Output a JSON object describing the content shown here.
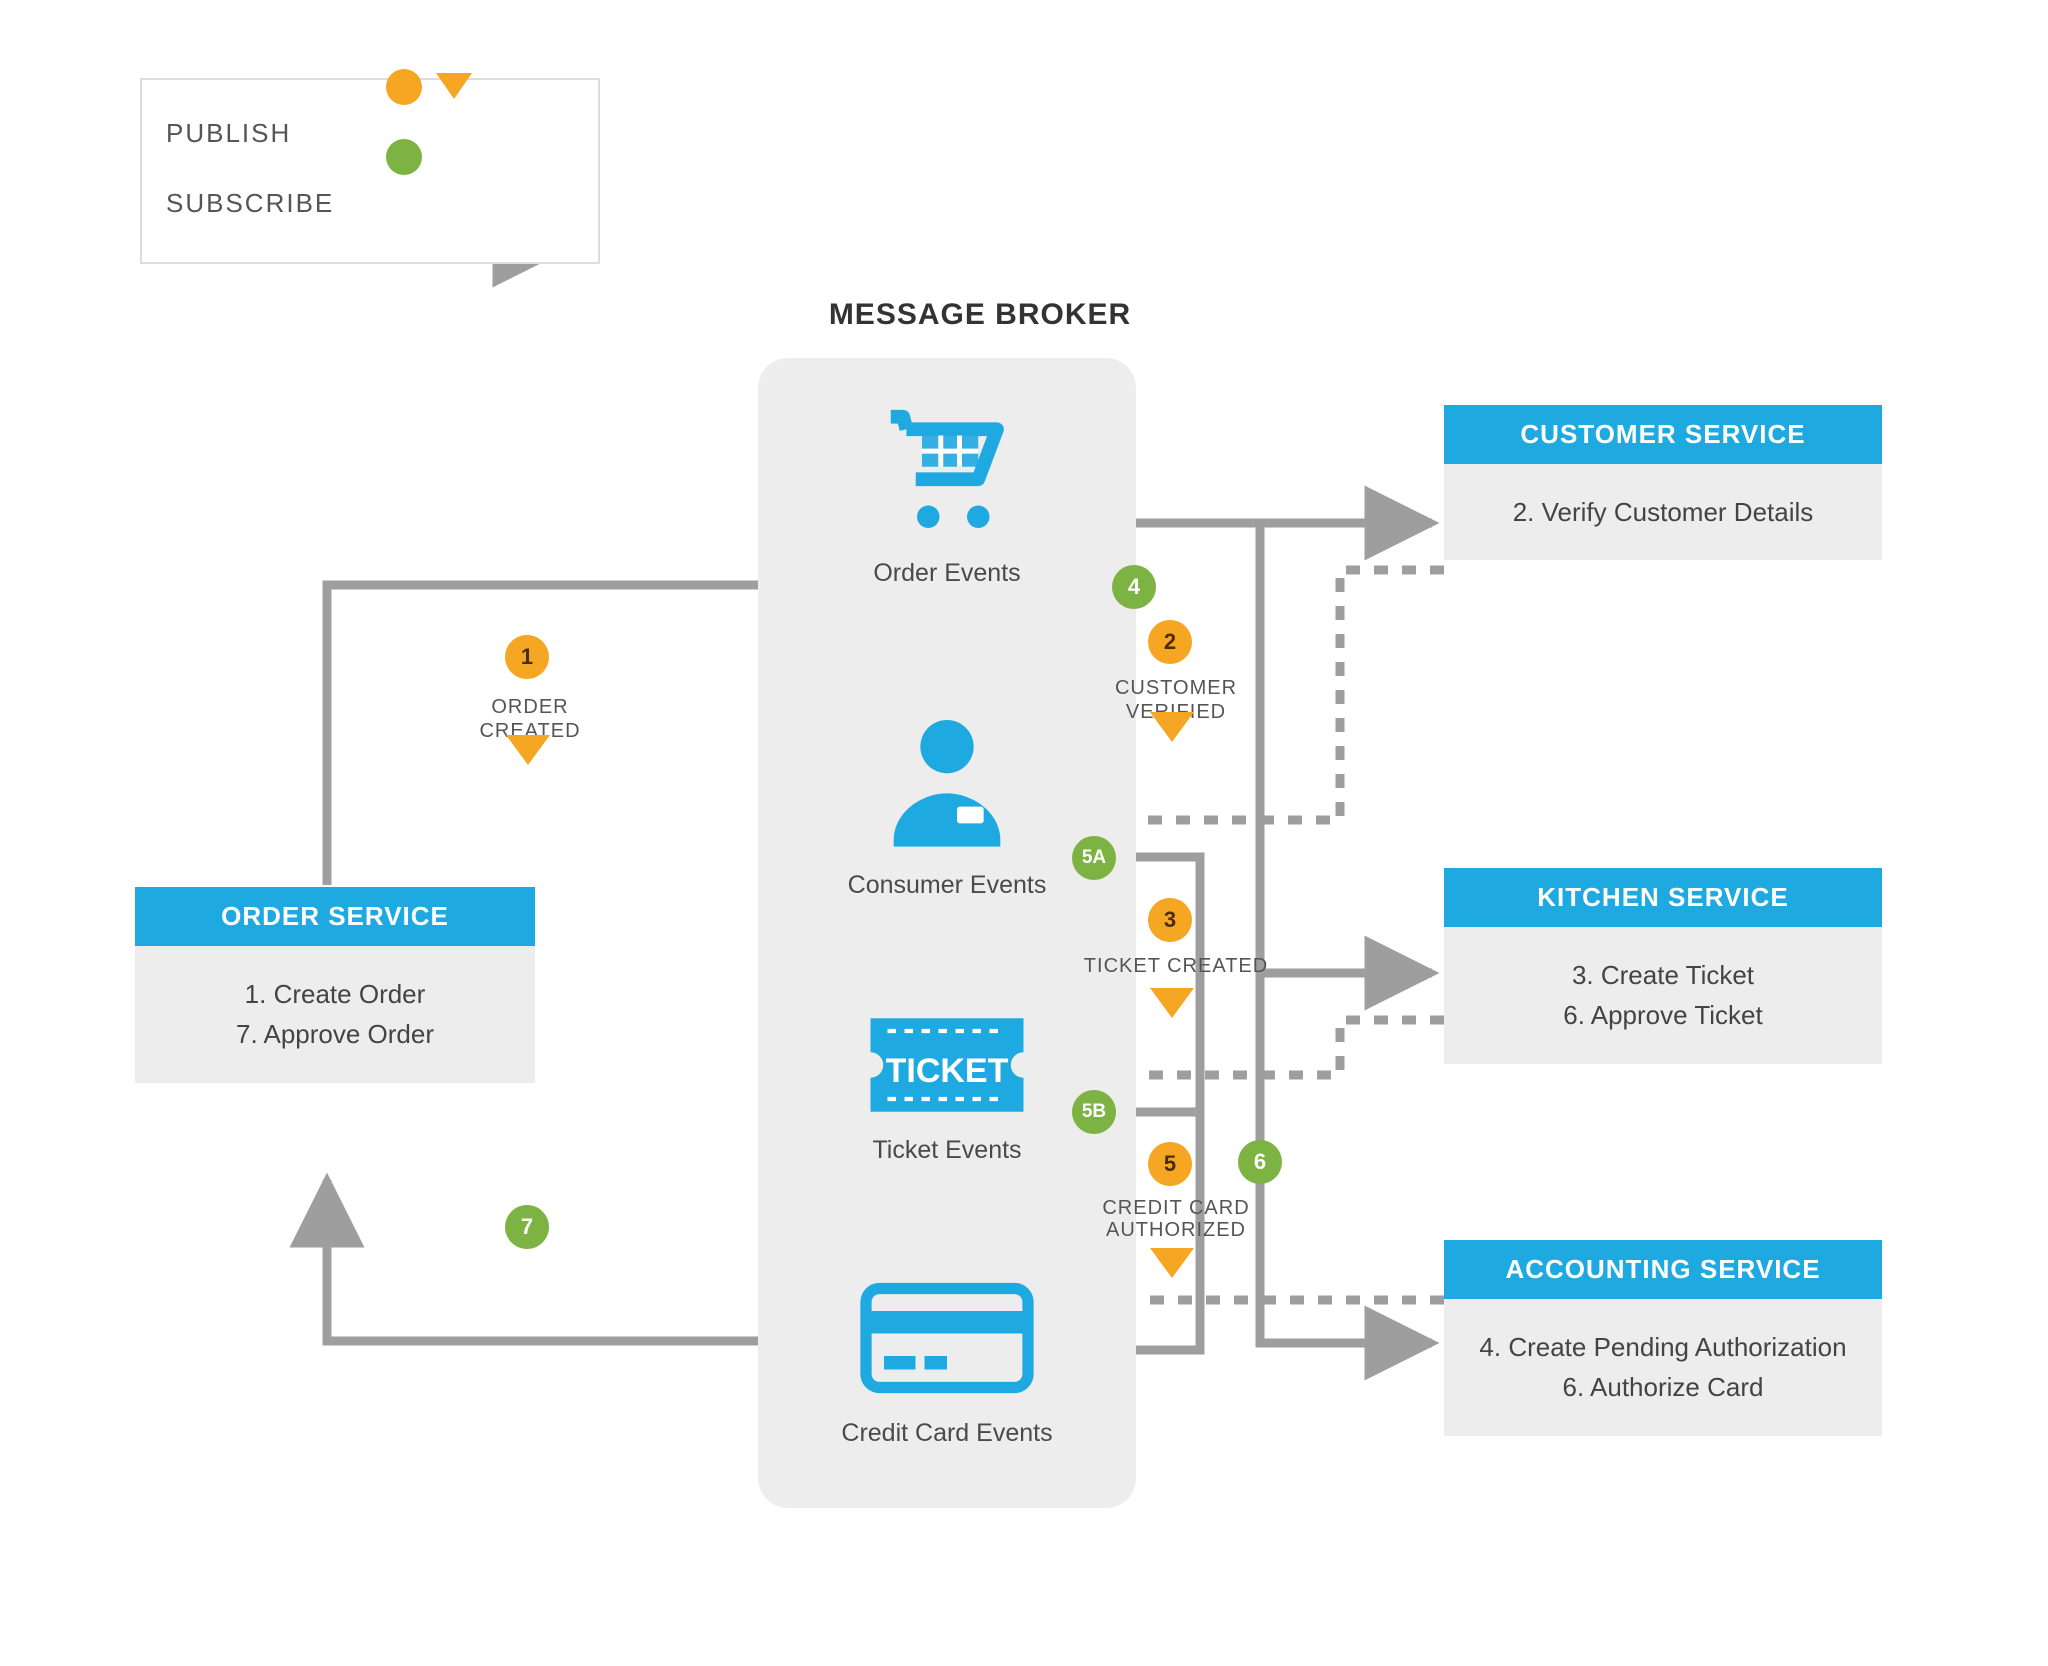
{
  "title": "MESSAGE BROKER",
  "legend": {
    "publish_label": "PUBLISH",
    "subscribe_label": "SUBSCRIBE"
  },
  "broker": {
    "order_events": "Order Events",
    "consumer_events": "Consumer Events",
    "ticket_events": "Ticket Events",
    "credit_events": "Credit Card Events"
  },
  "services": {
    "order": {
      "title": "ORDER SERVICE",
      "line1": "1. Create Order",
      "line2": "7. Approve Order"
    },
    "customer": {
      "title": "CUSTOMER SERVICE",
      "line1": "2. Verify Customer Details"
    },
    "kitchen": {
      "title": "KITCHEN SERVICE",
      "line1": "3. Create Ticket",
      "line2": "6. Approve Ticket"
    },
    "accounting": {
      "title": "ACCOUNTING SERVICE",
      "line1": "4. Create Pending Authorization",
      "line2": "6. Authorize Card"
    }
  },
  "steps": {
    "s1": "1",
    "s2": "2",
    "s3": "3",
    "s4": "4",
    "s5": "5",
    "s5a": "5A",
    "s5b": "5B",
    "s6": "6",
    "s7": "7",
    "order_created": "ORDER CREATED",
    "customer_verified": "CUSTOMER VERIFIED",
    "ticket_created": "TICKET CREATED",
    "credit_authorized_l1": "CREDIT CARD",
    "credit_authorized_l2": "AUTHORIZED"
  },
  "colors": {
    "blue": "#1fa9e1",
    "grey": "#9e9e9e",
    "grey_light": "#ededed",
    "orange": "#f5a623",
    "green": "#7cb342"
  }
}
